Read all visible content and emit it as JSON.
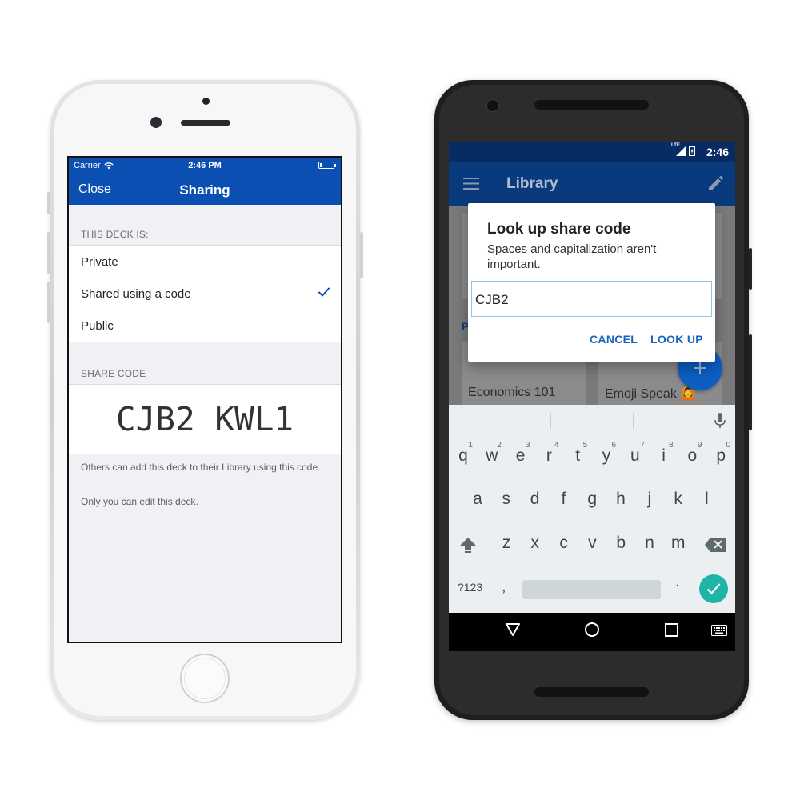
{
  "ios": {
    "status": {
      "carrier": "Carrier",
      "time": "2:46 PM"
    },
    "nav": {
      "close_label": "Close",
      "title": "Sharing"
    },
    "deck_section_header": "THIS DECK IS:",
    "options": [
      {
        "label": "Private",
        "selected": false
      },
      {
        "label": "Shared using a code",
        "selected": true
      },
      {
        "label": "Public",
        "selected": false
      }
    ],
    "share_code_header": "SHARE CODE",
    "share_code": "CJB2 KWL1",
    "footer_line1": "Others can add this deck to their Library using this code.",
    "footer_line2": "Only you can edit this deck.",
    "colors": {
      "nav": "#0b4fb3",
      "check": "#0b4fb3"
    }
  },
  "android": {
    "status": {
      "time": "2:46",
      "network": "LTE"
    },
    "appbar": {
      "title": "Library",
      "menu_icon": "menu-icon",
      "edit_icon": "edit-pencil-icon"
    },
    "cards": [
      {
        "label": "Economics 101"
      },
      {
        "label": "Emoji Speak 🙆"
      }
    ],
    "section_letter": "P",
    "dialog": {
      "title": "Look up share code",
      "message": "Spaces and capitalization aren't important.",
      "input_value": "CJB2",
      "cancel_label": "CANCEL",
      "lookup_label": "LOOK UP"
    },
    "keyboard": {
      "row1": [
        "q",
        "w",
        "e",
        "r",
        "t",
        "y",
        "u",
        "i",
        "o",
        "p"
      ],
      "row1_numbers": [
        "1",
        "2",
        "3",
        "4",
        "5",
        "6",
        "7",
        "8",
        "9",
        "0"
      ],
      "row2": [
        "a",
        "s",
        "d",
        "f",
        "g",
        "h",
        "j",
        "k",
        "l"
      ],
      "row3": [
        "z",
        "x",
        "c",
        "v",
        "b",
        "n",
        "m"
      ],
      "symbols_label": "?123",
      "comma": ",",
      "period": "."
    },
    "colors": {
      "appbar": "#0a3a7e",
      "accent": "#1565c0",
      "enter": "#1fb5a6"
    }
  }
}
